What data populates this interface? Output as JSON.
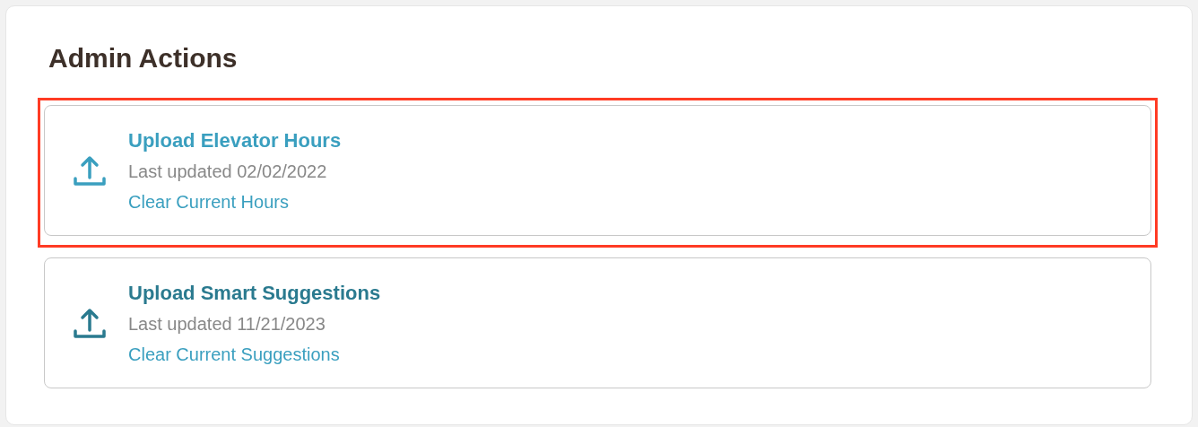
{
  "panel": {
    "title": "Admin Actions"
  },
  "actions": [
    {
      "title": "Upload Elevator Hours",
      "updated": "Last updated 02/02/2022",
      "link": "Clear Current Hours",
      "selected": true
    },
    {
      "title": "Upload Smart Suggestions",
      "updated": "Last updated 11/21/2023",
      "link": "Clear Current Suggestions",
      "selected": false
    }
  ]
}
